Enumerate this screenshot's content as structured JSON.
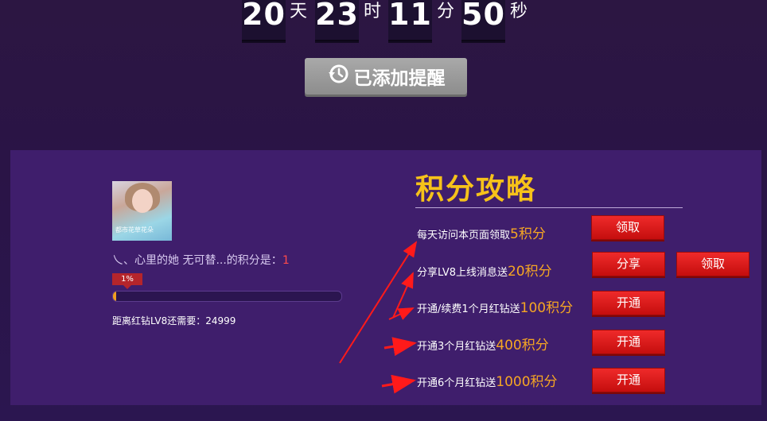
{
  "countdown": {
    "days": "20",
    "days_unit": "天",
    "hours": "23",
    "hours_unit": "时",
    "minutes": "11",
    "minutes_unit": "分",
    "seconds": "50",
    "seconds_unit": "秒"
  },
  "remind_button": {
    "label": "已添加提醒",
    "icon": "clock-history-icon"
  },
  "user": {
    "avatar_watermark": "都市花草花朵",
    "nickname_prefix": "乀、心里的她 无可替...的积分是：",
    "points": "1",
    "progress_label": "1%",
    "progress": 0.01,
    "need_text": "距离红钻LV8还需要：24999"
  },
  "strategy": {
    "title": "积分攻略",
    "tasks": [
      {
        "text": "每天访问本页面领取",
        "reward": "5积分",
        "button": "领取"
      },
      {
        "text": "分享LV8上线消息送",
        "reward": "20积分",
        "button": "分享",
        "button2": "领取"
      },
      {
        "text": "开通/续费1个月红钻送",
        "reward": "100积分",
        "button": "开通"
      },
      {
        "text": "开通3个月红钻送",
        "reward": "400积分",
        "button": "开通"
      },
      {
        "text": "开通6个月红钻送",
        "reward": "1000积分",
        "button": "开通"
      }
    ]
  },
  "colors": {
    "accent_gold": "#f6c21a",
    "reward_orange": "#f6a623",
    "button_red": "#d41616",
    "panel": "#3f1e6c"
  }
}
